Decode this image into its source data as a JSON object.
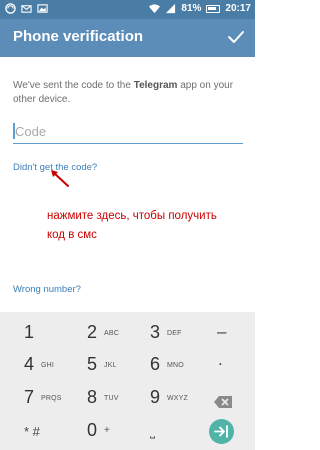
{
  "status_bar": {
    "battery_percent": "81%",
    "time": "20:17",
    "icons": [
      "sync-icon",
      "mail-icon",
      "image-icon",
      "wifi-icon",
      "signal-icon",
      "battery-icon"
    ]
  },
  "toolbar": {
    "title": "Phone verification",
    "confirm_icon": "checkmark-icon"
  },
  "info": {
    "text_before": "We've sent the code to the ",
    "app_name": "Telegram",
    "text_after": " app on your other device."
  },
  "code_input": {
    "placeholder": "Code",
    "value": ""
  },
  "links": {
    "didnt_get_code": "Didn't get the code?",
    "wrong_number": "Wrong number?"
  },
  "annotation": {
    "line1": "нажмите здесь, чтобы получить",
    "line2": "код в смс",
    "color": "#cc0000"
  },
  "keypad": {
    "keys": [
      {
        "num": "1",
        "letters": ""
      },
      {
        "num": "2",
        "letters": "ABC"
      },
      {
        "num": "3",
        "letters": "DEF"
      },
      {
        "num": "–",
        "letters": ""
      },
      {
        "num": "4",
        "letters": "GHI"
      },
      {
        "num": "5",
        "letters": "JKL"
      },
      {
        "num": "6",
        "letters": "MNO"
      },
      {
        "num": ".",
        "letters": ""
      },
      {
        "num": "7",
        "letters": "PRQS"
      },
      {
        "num": "8",
        "letters": "TUV"
      },
      {
        "num": "9",
        "letters": "WXYZ"
      },
      {
        "num": "* #",
        "letters": ""
      },
      {
        "num": "0",
        "letters": "+"
      },
      {
        "num": "˽",
        "letters": ""
      }
    ]
  },
  "colors": {
    "status_bar": "#4a7da6",
    "toolbar": "#5b8db8",
    "accent": "#5b9fd2",
    "link": "#3d7fba",
    "go_button": "#4fb3a8"
  }
}
